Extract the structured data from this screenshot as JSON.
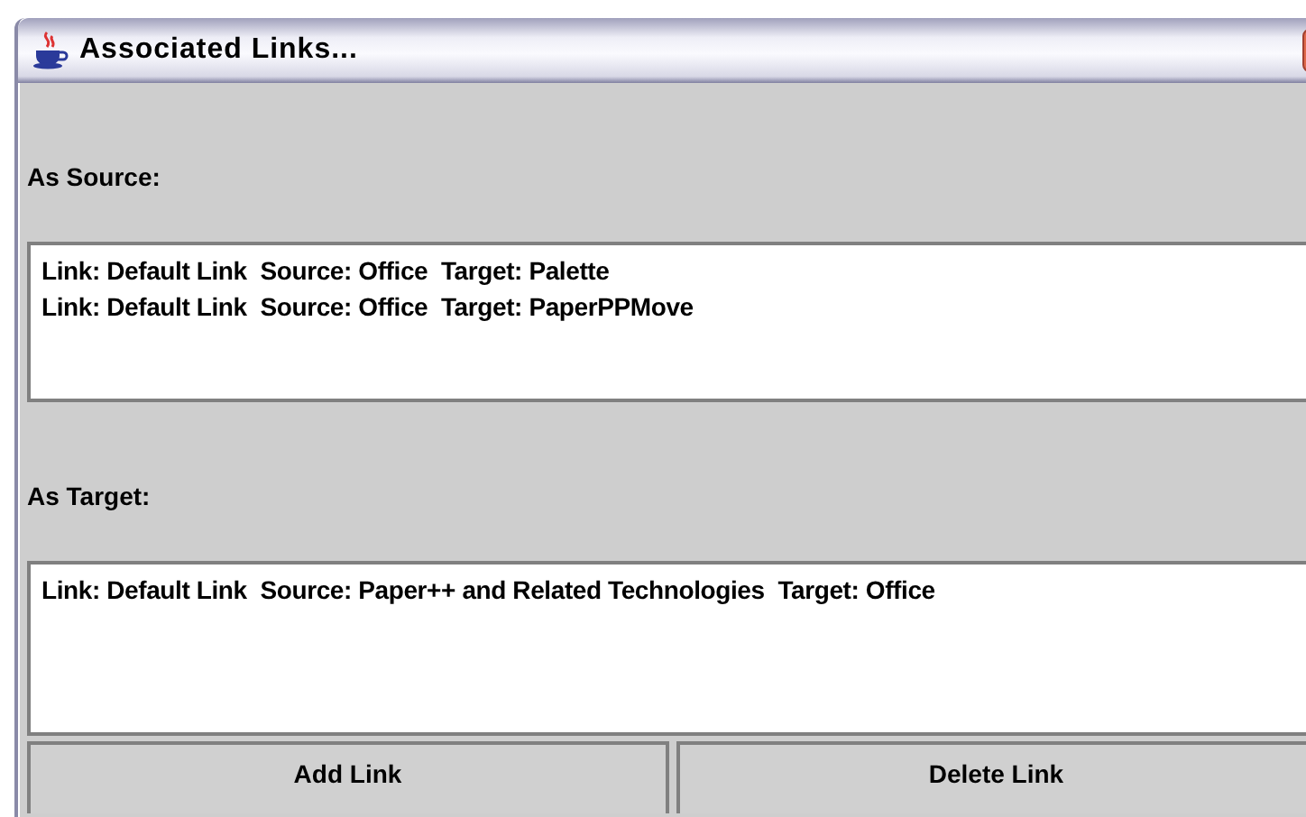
{
  "window": {
    "title": "Associated Links..."
  },
  "sections": [
    {
      "label": "As Source:",
      "links": [
        "Link: Default Link  Source: Office  Target: Palette",
        "Link: Default Link  Source: Office  Target: PaperPPMove"
      ]
    },
    {
      "label": "As Target:",
      "links": [
        "Link: Default Link  Source: Paper++ and Related Technologies  Target: Office"
      ]
    }
  ],
  "buttons": [
    "Add Link",
    "Delete Link"
  ]
}
